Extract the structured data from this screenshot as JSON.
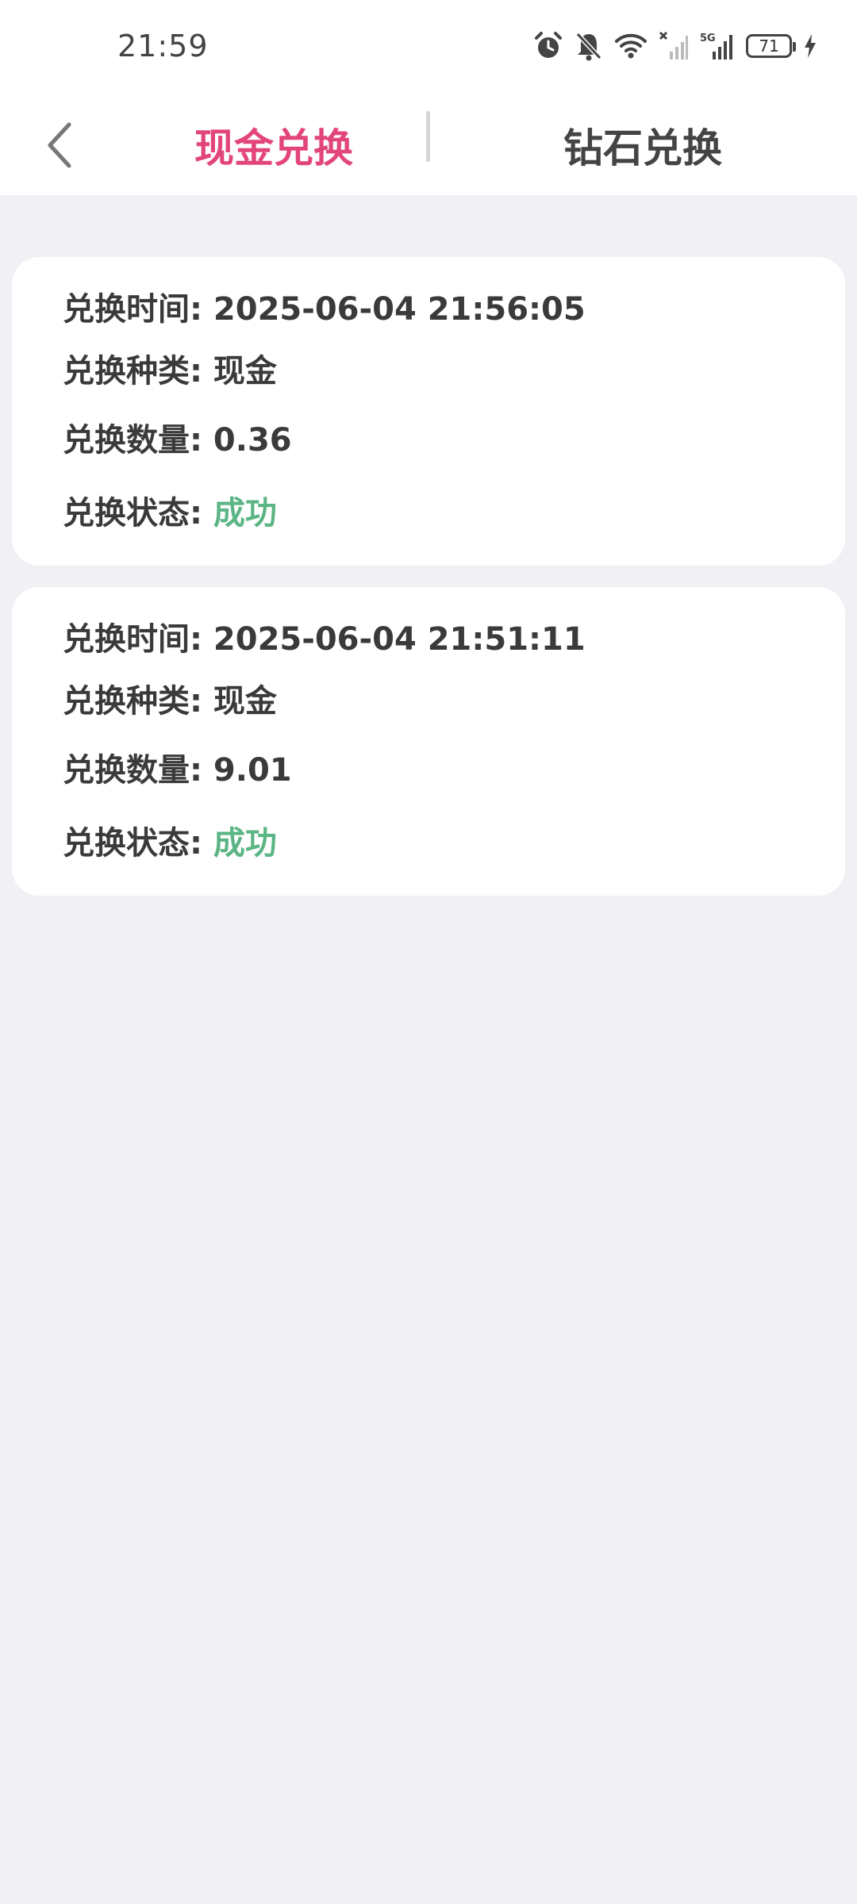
{
  "status_bar": {
    "time": "21:59",
    "battery": "71",
    "network": "5G"
  },
  "header": {
    "tabs": [
      {
        "label": "现金兑换",
        "active": true,
        "color": "#e2457a"
      },
      {
        "label": "钻石兑换",
        "active": false,
        "color": "#444444"
      }
    ]
  },
  "records": [
    {
      "time_label": "兑换时间: ",
      "time_value": "2025-06-04 21:56:05",
      "type_label": "兑换种类: ",
      "type_value": "现金",
      "amount_label": "兑换数量: ",
      "amount_value": "0.36",
      "status_label": "兑换状态: ",
      "status_value": "成功"
    },
    {
      "time_label": "兑换时间: ",
      "time_value": "2025-06-04 21:51:11",
      "type_label": "兑换种类: ",
      "type_value": "现金",
      "amount_label": "兑换数量: ",
      "amount_value": "9.01",
      "status_label": "兑换状态: ",
      "status_value": "成功"
    }
  ],
  "colors": {
    "accent": "#e2457a",
    "success": "#5cb584",
    "background": "#f0f0f5"
  }
}
